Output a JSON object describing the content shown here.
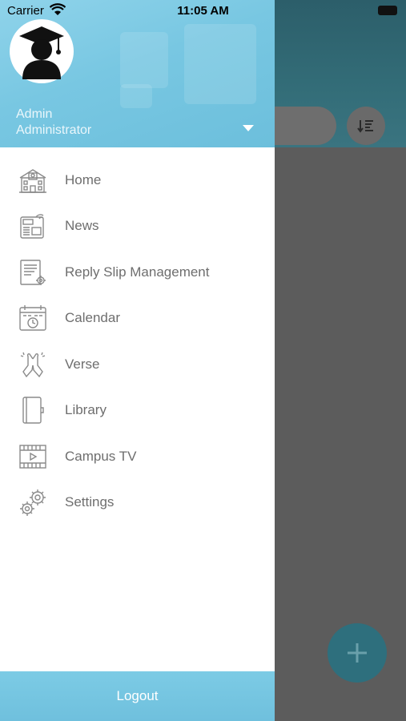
{
  "status_bar": {
    "carrier": "Carrier",
    "time": "11:05 AM"
  },
  "user": {
    "role": "Admin",
    "name": "Administrator"
  },
  "menu": {
    "items": [
      {
        "label": "Home",
        "icon": "school-building-icon"
      },
      {
        "label": "News",
        "icon": "newspaper-icon"
      },
      {
        "label": "Reply Slip Management",
        "icon": "document-settings-icon"
      },
      {
        "label": "Calendar",
        "icon": "calendar-clock-icon"
      },
      {
        "label": "Verse",
        "icon": "praying-hands-icon"
      },
      {
        "label": "Library",
        "icon": "book-icon"
      },
      {
        "label": "Campus TV",
        "icon": "film-play-icon"
      },
      {
        "label": "Settings",
        "icon": "gears-icon"
      }
    ]
  },
  "footer": {
    "logout_label": "Logout"
  },
  "colors": {
    "drawer_header": "#78c7e2",
    "menu_text": "#6e6e6e",
    "icon_stroke": "#8a8a8a",
    "overlay": "#5c5c5c",
    "fab": "#2e6f7d"
  }
}
